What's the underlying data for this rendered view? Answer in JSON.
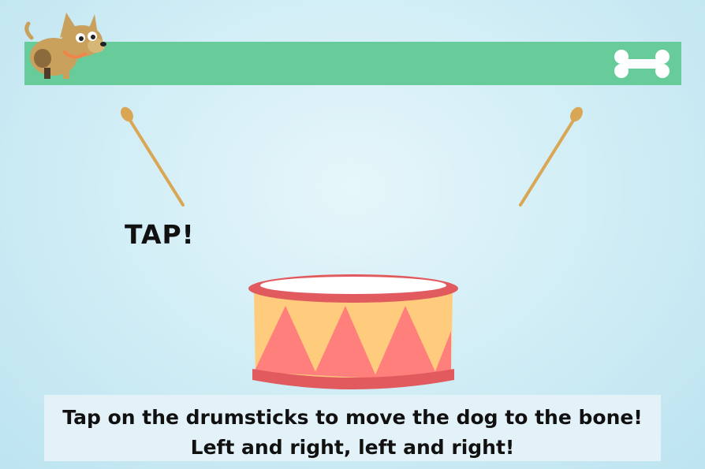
{
  "game": {
    "tap_label": "TAP!",
    "instructions": {
      "line1": "Tap on the drumsticks to move the dog to the bone!",
      "line2": "Left and right, left and right!"
    },
    "progress": 0
  },
  "icons": {
    "dog": "dog-icon",
    "bone": "bone-icon",
    "drumstick": "drumstick-icon",
    "drum": "drum-icon"
  },
  "colors": {
    "track": "#67cc9a",
    "drum_rim": "#e05a5e",
    "drum_triangle": "#ff7f7c",
    "drum_band": "#ffcc7e",
    "drumstick": "#d9a654"
  }
}
